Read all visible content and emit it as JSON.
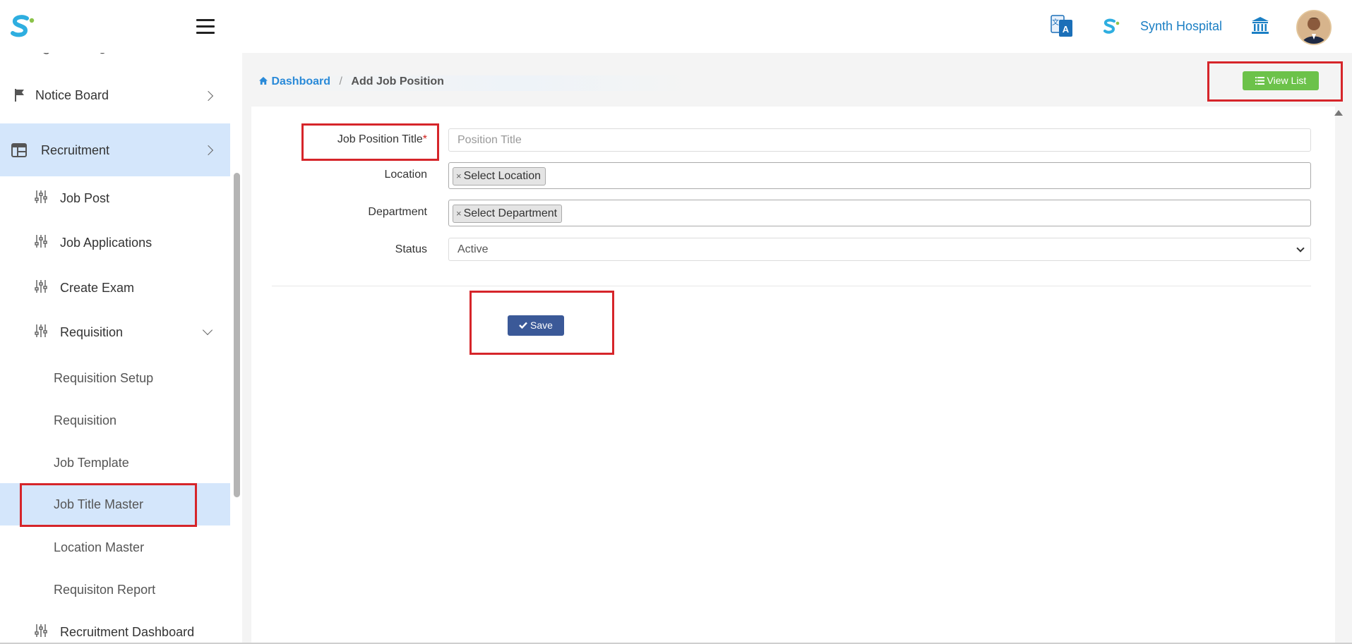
{
  "header": {
    "hospital_name": "Synth Hospital",
    "icons": [
      "app-logo-icon",
      "menu-icon",
      "translate-icon",
      "brand-mark-icon",
      "institution-icon",
      "user-avatar"
    ]
  },
  "sidebar": {
    "items": [
      {
        "label": "Notice Board",
        "icon": "flag-icon",
        "chevron": "right"
      },
      {
        "label": "Recruitment",
        "icon": "table-icon",
        "chevron": "right",
        "active": true
      },
      {
        "label": "Job Post",
        "icon": "sliders-icon"
      },
      {
        "label": "Job Applications",
        "icon": "sliders-icon"
      },
      {
        "label": "Create Exam",
        "icon": "sliders-icon"
      },
      {
        "label": "Requisition",
        "icon": "sliders-icon",
        "chevron": "down"
      },
      {
        "label": "Requisition Setup"
      },
      {
        "label": "Requisition"
      },
      {
        "label": "Job Template"
      },
      {
        "label": "Job Title Master",
        "active": true
      },
      {
        "label": "Location Master"
      },
      {
        "label": "Requisiton Report"
      },
      {
        "label": "Recruitment Dashboard",
        "icon": "sliders-icon"
      }
    ]
  },
  "breadcrumb": {
    "home": "Dashboard",
    "current": "Add Job Position"
  },
  "toolbar": {
    "view_list_label": "View List"
  },
  "form": {
    "title_label": "Job Position Title",
    "required_mark": "*",
    "title_placeholder": "Position Title",
    "location_label": "Location",
    "location_chip": "Select Location",
    "department_label": "Department",
    "department_chip": "Select Department",
    "status_label": "Status",
    "status_value": "Active",
    "save_label": "Save"
  },
  "colors": {
    "accent_blue": "#2a8ad8",
    "active_sidebar_bg": "#d4e6fb",
    "view_list_green": "#6cc24a",
    "save_blue": "#3b5998",
    "highlight_red": "#d6252a"
  }
}
